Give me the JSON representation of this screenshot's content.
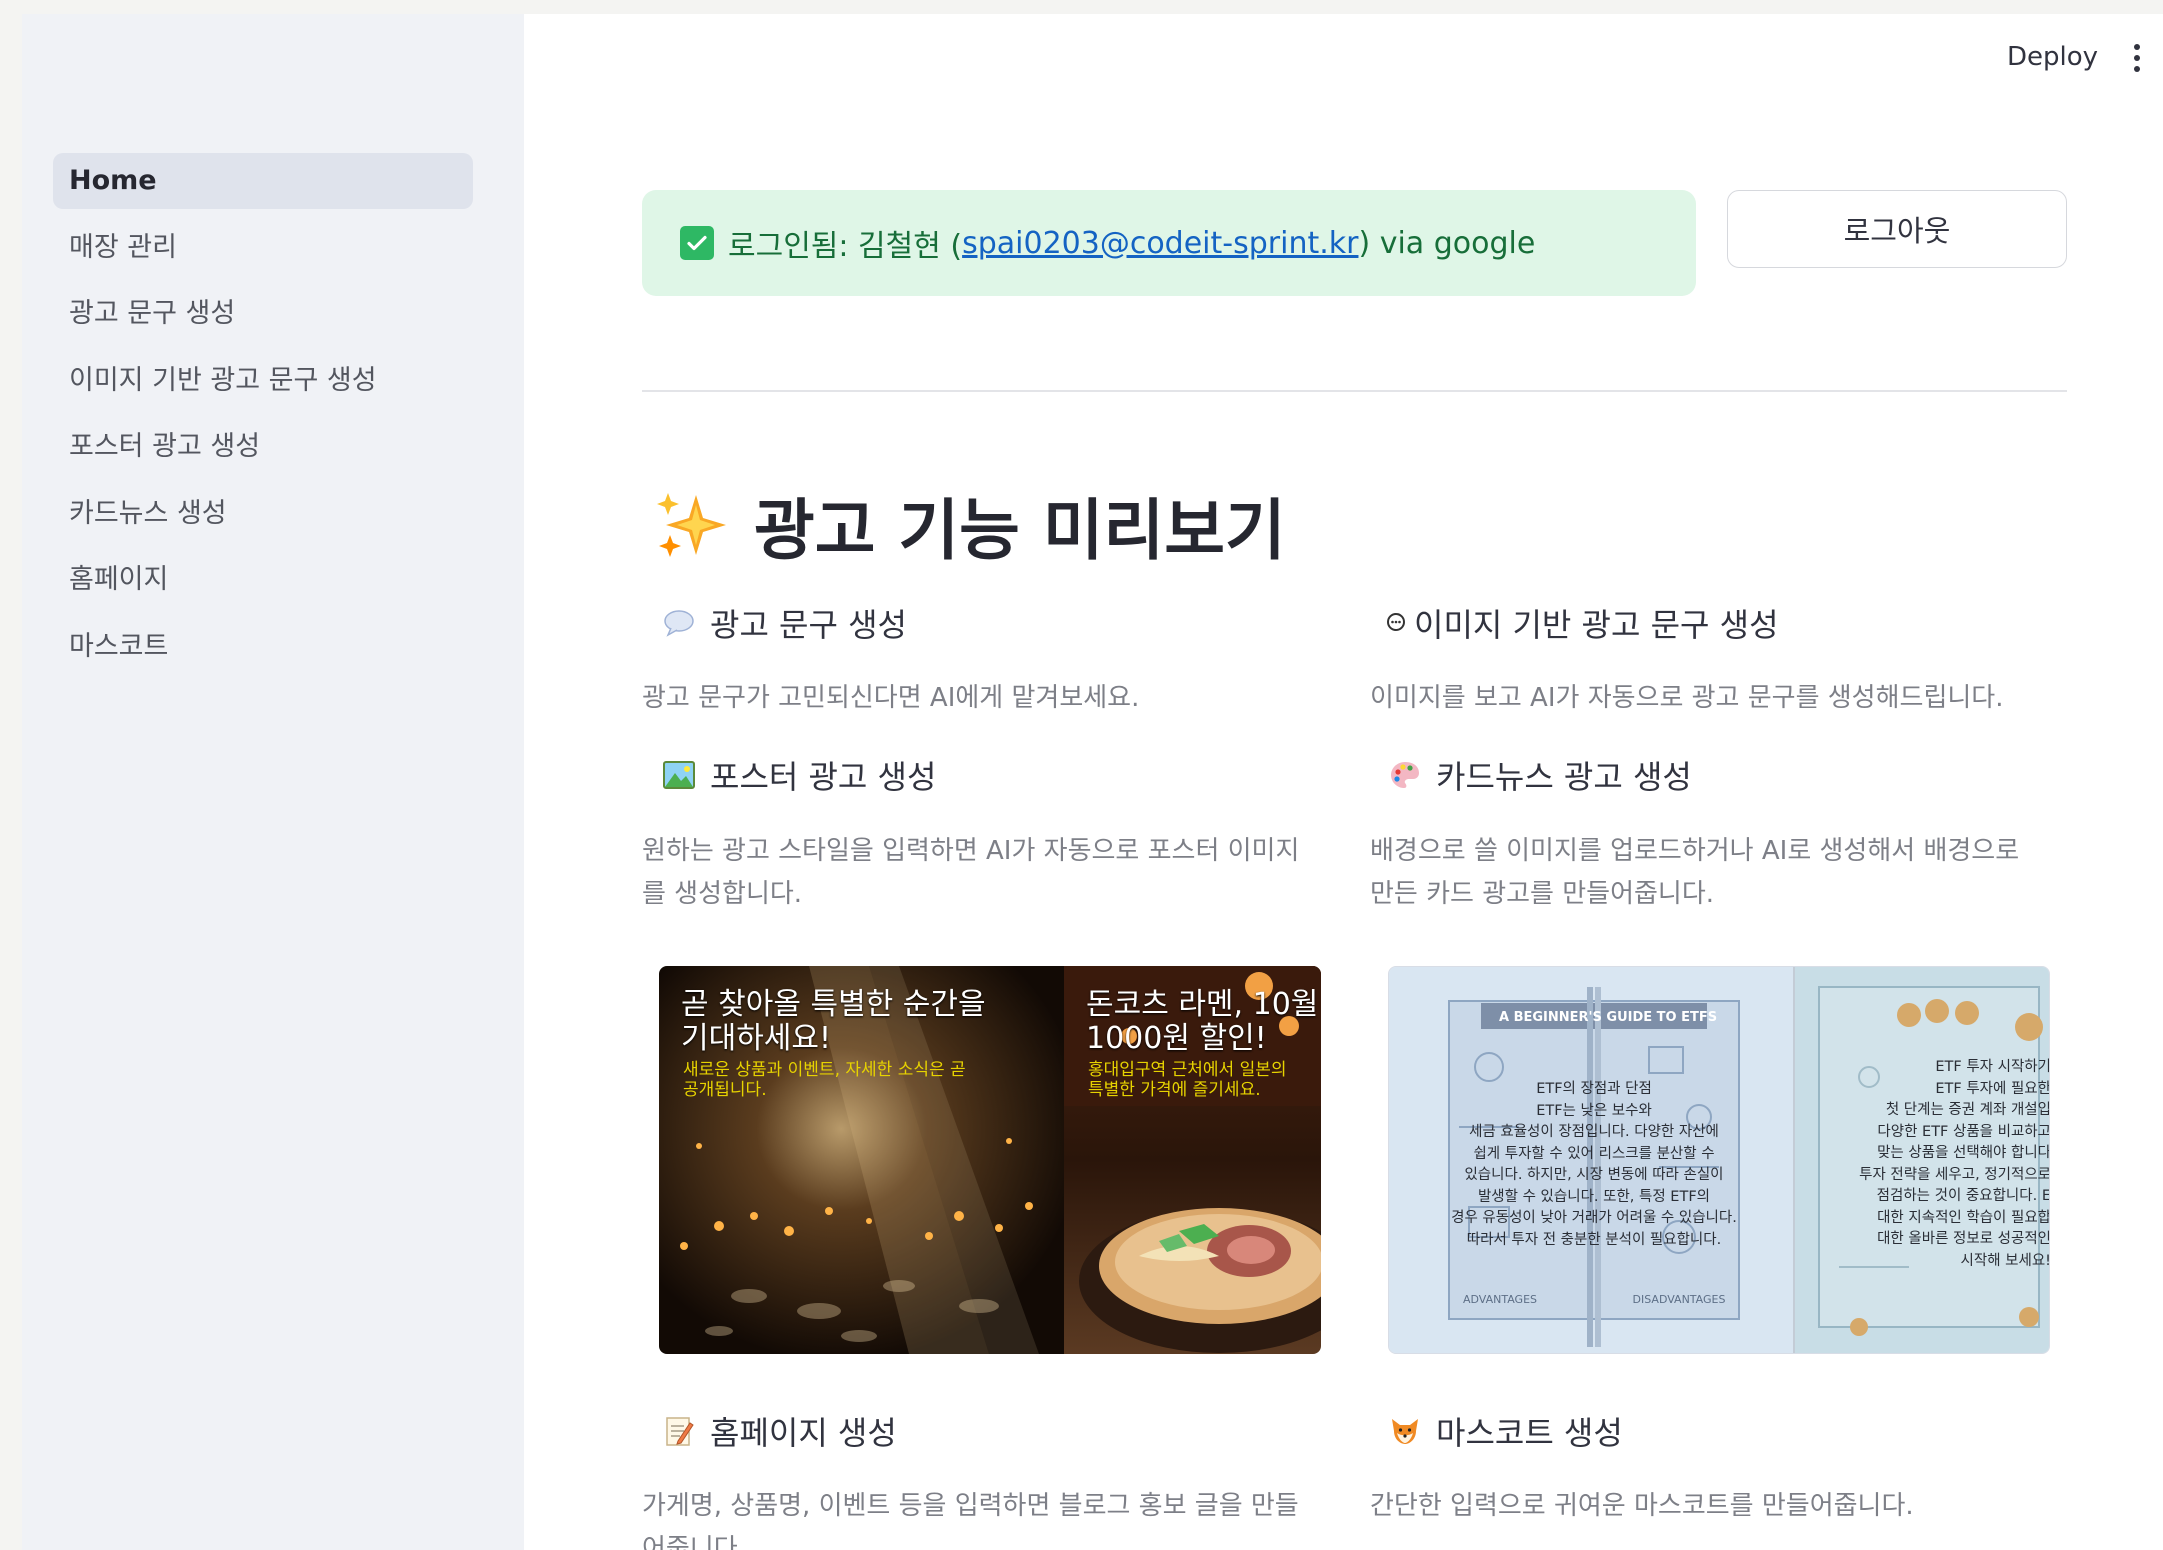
{
  "header": {
    "deploy_label": "Deploy"
  },
  "sidebar": {
    "items": [
      {
        "label": "Home",
        "active": true
      },
      {
        "label": "매장 관리"
      },
      {
        "label": "광고 문구 생성"
      },
      {
        "label": "이미지 기반 광고 문구 생성"
      },
      {
        "label": "포스터 광고 생성"
      },
      {
        "label": "카드뉴스 생성"
      },
      {
        "label": "홈페이지"
      },
      {
        "label": "마스코트"
      }
    ]
  },
  "login": {
    "prefix": "로그인됨: 김철현 (",
    "email": "spai0203@codeit-sprint.kr",
    "suffix": ") via google",
    "logout_label": "로그아웃"
  },
  "main": {
    "title": "광고 기능 미리보기"
  },
  "features": {
    "ad_copy": {
      "title": "광고 문구 생성",
      "desc": "광고 문구가 고민되신다면 AI에게 맡겨보세요."
    },
    "image_copy": {
      "title": "이미지 기반 광고 문구 생성",
      "desc": "이미지를 보고 AI가 자동으로 광고 문구를 생성해드립니다."
    },
    "poster": {
      "title": "포스터 광고 생성",
      "desc_line1": "원하는 광고 스타일을 입력하면 AI가 자동으로 포스터 이미지",
      "desc_line2": "를 생성합니다."
    },
    "cardnews": {
      "title": "카드뉴스 광고 생성",
      "desc_line1": "배경으로 쓸 이미지를 업로드하거나 AI로 생성해서 배경으로",
      "desc_line2": "만든 카드 광고를 만들어줍니다."
    },
    "homepage": {
      "title": "홈페이지 생성",
      "desc_line1": "가게명, 상품명, 이벤트 등을 입력하면 블로그 홍보 글을 만들",
      "desc_line2": "어줍니다."
    },
    "mascot": {
      "title": "마스코트 생성",
      "desc": "간단한 입력으로 귀여운 마스코트를 만들어줍니다."
    }
  },
  "poster_preview": {
    "left_title_1": "곧 찾아올 특별한 순간을",
    "left_title_2": "기대하세요!",
    "left_sub_1": "새로운 상품과 이벤트, 자세한 소식은 곧",
    "left_sub_2": "공개됩니다.",
    "right_title_1": "돈코츠 라멘, 10월",
    "right_title_2": "1000원 할인!",
    "right_sub_1": "홍대입구역 근처에서 일본의",
    "right_sub_2": "특별한 가격에 즐기세요."
  },
  "card_preview": {
    "banner": "A BEGINNER'S GUIDE TO ETFS",
    "left_lines": [
      "ETF의 장점과 단점",
      "ETF는 낮은 보수와",
      "세금 효율성이 장점입니다. 다양한 자산에",
      "쉽게 투자할 수 있어 리스크를 분산할 수",
      "있습니다. 하지만, 시장 변동에 따라 손실이",
      "발생할 수 있습니다. 또한, 특정 ETF의",
      "경우 유동성이 낮아 거래가 어려울 수 있습니다.",
      "따라서 투자 전 충분한 분석이 필요합니다."
    ],
    "advantages": "ADVANTAGES",
    "disadvantages": "DISADVANTAGES",
    "right_lines": [
      "ETF 투자 시작하기",
      "ETF 투자에 필요한",
      "첫 단계는 증권 계좌 개설입",
      "다양한 ETF 상품을 비교하고",
      "맞는 상품을 선택해야 합니다",
      "투자 전략을 세우고, 정기적으로",
      "점검하는 것이 중요합니다. E",
      "대한 지속적인 학습이 필요합",
      "대한 올바른 정보로 성공적인",
      "시작해 보세요!"
    ]
  }
}
